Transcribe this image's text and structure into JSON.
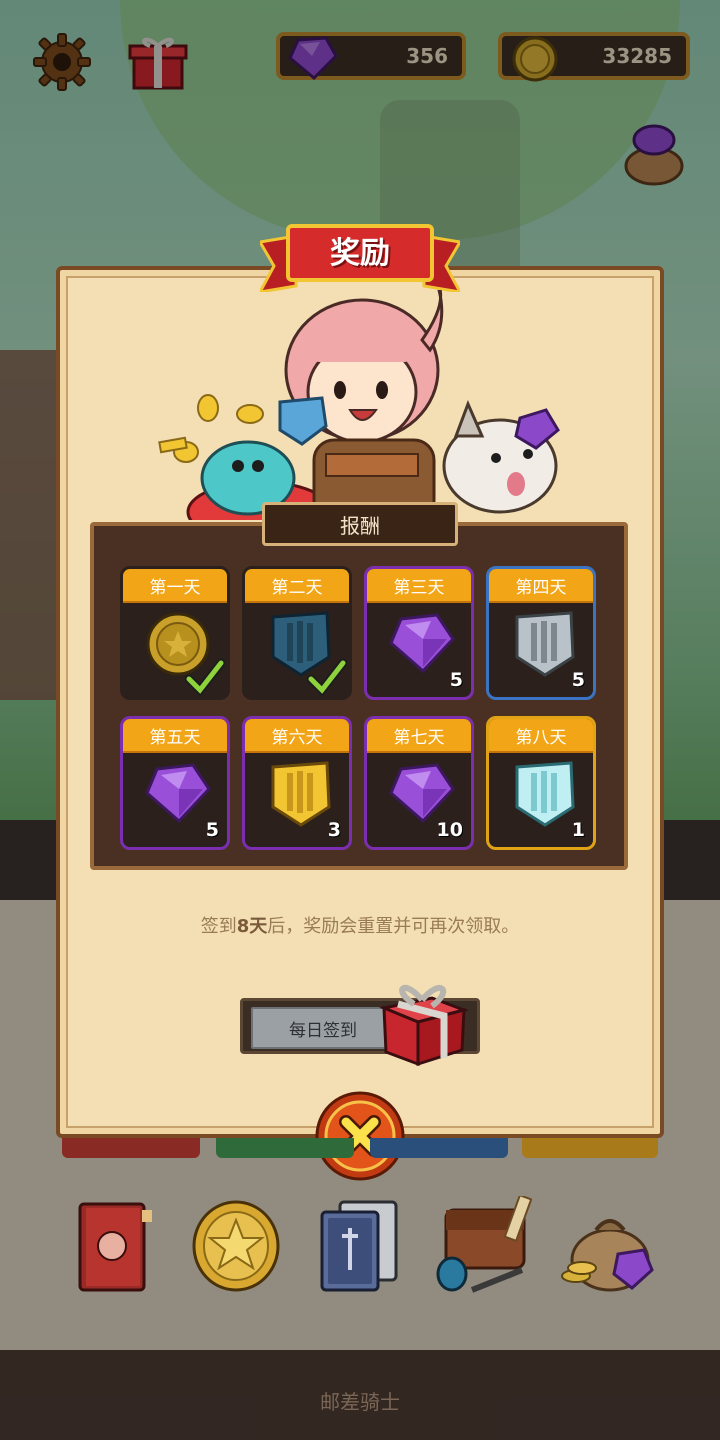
{
  "header": {
    "gems": "356",
    "coins": "33285"
  },
  "dialog": {
    "title": "奖励",
    "section_title": "报酬",
    "days": [
      {
        "label": "第一天",
        "reward": "coin",
        "count": "",
        "claimed": true
      },
      {
        "label": "第二天",
        "reward": "blue-shield",
        "count": "",
        "claimed": true
      },
      {
        "label": "第三天",
        "reward": "purple-gem",
        "count": "5",
        "claimed": false
      },
      {
        "label": "第四天",
        "reward": "silver-shield",
        "count": "5",
        "claimed": false
      },
      {
        "label": "第五天",
        "reward": "purple-gem",
        "count": "5",
        "claimed": false
      },
      {
        "label": "第六天",
        "reward": "gold-shield",
        "count": "3",
        "claimed": false
      },
      {
        "label": "第七天",
        "reward": "purple-gem",
        "count": "10",
        "claimed": false
      },
      {
        "label": "第八天",
        "reward": "ice-shield",
        "count": "1",
        "claimed": false
      }
    ],
    "note_prefix": "签到",
    "note_days": "8天",
    "note_suffix": "后，奖励会重置并可再次领取。",
    "sign_button": "每日签到"
  },
  "footer": {
    "title": "邮差骑士"
  },
  "colors": {
    "accent": "#f2a516",
    "ribbon": "#d62b2b",
    "panel": "#f3dfb3",
    "close": "#e2541a"
  }
}
